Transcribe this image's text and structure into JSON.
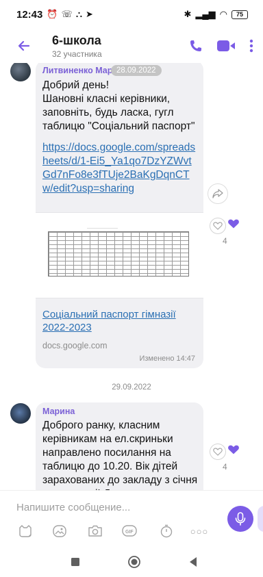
{
  "status_bar": {
    "time": "12:43",
    "battery": "75"
  },
  "header": {
    "title": "6-школа",
    "subtitle": "32 участника"
  },
  "messages": [
    {
      "sender": "Литвиненко Марина",
      "date_badge": "28.09.2022",
      "text": "Добрий день!\nШановні класні керівники, заповніть, будь ласка, гугл таблицю \"Соціальний паспорт\"",
      "link": "https://docs.google.com/spreadsheets/d/1-Ei5_Ya1qo7DzYZWvtGd7nFo8e3fTUje2BaKgDqnCTw/edit?usp=sharing",
      "preview": {
        "title": "Соціальний паспорт гімназії 2022-2023",
        "domain": "docs.google.com"
      },
      "edited_label": "Изменено",
      "time": "14:47",
      "like_count": "4"
    },
    {
      "sender": "Марина",
      "text": "Доброго ранку, класним керівникам на ел.скриньки направлено посилання на таблицю до 10.20. Вік дітей зарахованих до закладу з січня по сьогодні! Дякую",
      "like_count": "4"
    }
  ],
  "date_separator": "29.09.2022",
  "composer": {
    "placeholder": "Напишите сообщение..."
  },
  "colors": {
    "accent": "#7b5ce6",
    "link": "#2a6fb3",
    "bubble": "#f0f0f3",
    "sender": "#7b61d6"
  },
  "icons": {
    "header": [
      "back-arrow-icon",
      "phone-icon",
      "video-icon",
      "more-vertical-icon"
    ],
    "composer": [
      "sticker-icon",
      "image-icon",
      "camera-icon",
      "gif-icon",
      "timer-icon",
      "more-horizontal-icon",
      "microphone-icon"
    ],
    "nav": [
      "square-icon",
      "circle-icon",
      "triangle-back-icon"
    ]
  }
}
